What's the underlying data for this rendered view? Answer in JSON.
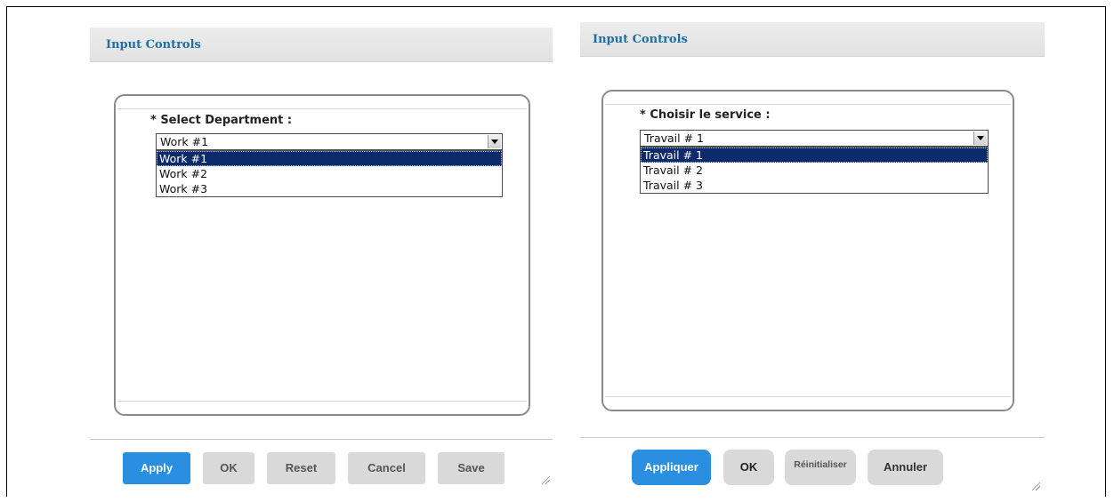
{
  "panels": [
    {
      "title": "Input Controls",
      "field_label": "* Select Department :",
      "selected_value": "Work #1",
      "options": [
        "Work #1",
        "Work #2",
        "Work #3"
      ],
      "buttons": {
        "apply": "Apply",
        "ok": "OK",
        "reset": "Reset",
        "cancel": "Cancel",
        "save": "Save"
      }
    },
    {
      "title": "Input Controls",
      "field_label": "* Choisir le service :",
      "selected_value": "Travail # 1",
      "options": [
        "Travail # 1",
        "Travail # 2",
        "Travail # 3"
      ],
      "buttons": {
        "apply": "Appliquer",
        "ok": "OK",
        "reset": "Réinitialiser",
        "cancel": "Annuler"
      }
    }
  ],
  "colors": {
    "title": "#1d6fa5",
    "primary_button": "#2a8fe0",
    "selected_option": "#0d2a6b"
  },
  "icons": [
    "dropdown-arrow-icon",
    "resize-grip-icon"
  ]
}
